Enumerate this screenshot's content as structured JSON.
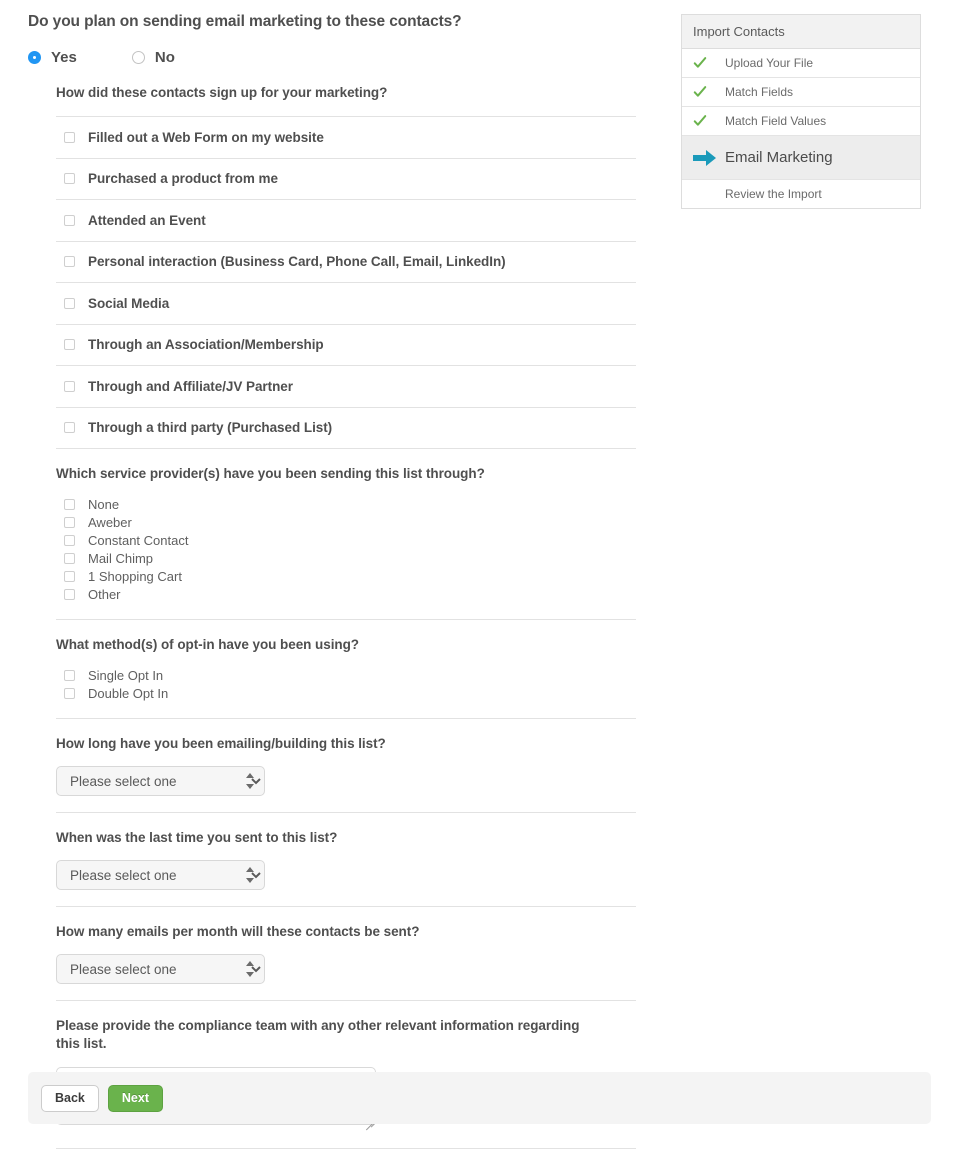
{
  "main": {
    "top_question": "Do you plan on sending email marketing to these contacts?",
    "radios": [
      {
        "label": "Yes",
        "checked": true
      },
      {
        "label": "No",
        "checked": false
      }
    ],
    "signup_question": "How did these contacts sign up for your marketing?",
    "signup_options": [
      "Filled out a Web Form on my website",
      "Purchased a product from me",
      "Attended an Event",
      "Personal interaction (Business Card, Phone Call, Email, LinkedIn)",
      "Social Media",
      "Through an Association/Membership",
      "Through and Affiliate/JV Partner",
      "Through a third party (Purchased List)"
    ],
    "provider_question": "Which service provider(s) have you been sending this list through?",
    "provider_options": [
      "None",
      "Aweber",
      "Constant Contact",
      "Mail Chimp",
      "1 Shopping Cart",
      "Other"
    ],
    "optin_question": "What method(s) of opt-in have you been using?",
    "optin_options": [
      "Single Opt In",
      "Double Opt In"
    ],
    "duration_question": "How long have you been emailing/building this list?",
    "duration_value": "Please select one",
    "lastsent_question": "When was the last time you sent to this list?",
    "lastsent_value": "Please select one",
    "volume_question": "How many emails per month will these contacts be sent?",
    "volume_value": "Please select one",
    "notes_question": "Please provide the compliance team with any other relevant information regarding this list.",
    "notes_value": "",
    "notes_placeholder": ""
  },
  "footer": {
    "back_label": "Back",
    "next_label": "Next"
  },
  "sidebar": {
    "title": "Import Contacts",
    "items": [
      {
        "label": "Upload Your File",
        "icon": "check-icon",
        "state": "done"
      },
      {
        "label": "Match Fields",
        "icon": "check-icon",
        "state": "done"
      },
      {
        "label": "Match Field Values",
        "icon": "check-icon",
        "state": "done"
      },
      {
        "label": "Email Marketing",
        "icon": "arrow-right-icon",
        "state": "active"
      },
      {
        "label": "Review the Import",
        "icon": "none",
        "state": "pending"
      }
    ]
  },
  "colors": {
    "accent_blue": "#2196f3",
    "check_green": "#6ab34c",
    "arrow_teal": "#1a9aba",
    "next_green": "#6ab34c",
    "text": "#4f4f4f",
    "rule": "#e2e2e2"
  }
}
